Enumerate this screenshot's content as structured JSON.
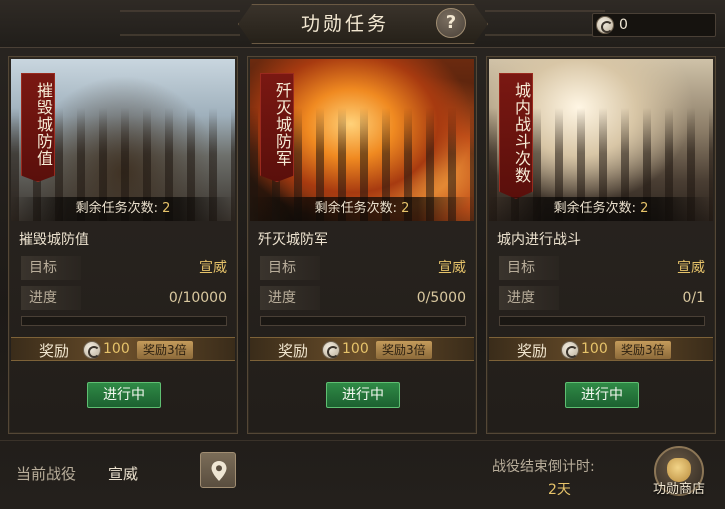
{
  "header": {
    "title": "功勋任务",
    "help_label": "?",
    "currency_value": "0"
  },
  "cards": [
    {
      "banner": "摧毁城防值",
      "remaining_label": "剩余任务次数:",
      "remaining_count": "2",
      "name": "摧毁城防值",
      "target_label": "目标",
      "target_value": "宣威",
      "progress_label": "进度",
      "progress_value": "0/10000",
      "progress_fraction": 0,
      "reward_label": "奖励",
      "reward_amount": "100",
      "reward_multiplier": "奖励3倍",
      "status": "进行中"
    },
    {
      "banner": "歼灭城防军",
      "remaining_label": "剩余任务次数:",
      "remaining_count": "2",
      "name": "歼灭城防军",
      "target_label": "目标",
      "target_value": "宣威",
      "progress_label": "进度",
      "progress_value": "0/5000",
      "progress_fraction": 0,
      "reward_label": "奖励",
      "reward_amount": "100",
      "reward_multiplier": "奖励3倍",
      "status": "进行中"
    },
    {
      "banner": "城内战斗次数",
      "remaining_label": "剩余任务次数:",
      "remaining_count": "2",
      "name": "城内进行战斗",
      "target_label": "目标",
      "target_value": "宣威",
      "progress_label": "进度",
      "progress_value": "0/1",
      "progress_fraction": 0,
      "reward_label": "奖励",
      "reward_amount": "100",
      "reward_multiplier": "奖励3倍",
      "status": "进行中"
    }
  ],
  "footer": {
    "campaign_label": "当前战役",
    "campaign_value": "宣威",
    "countdown_label": "战役结束倒计时:",
    "countdown_value": "2天",
    "shop_label": "功勋商店"
  },
  "icons": {
    "coin": "merit-coin-icon",
    "map": "map-pin-icon",
    "shop": "money-bag-icon"
  },
  "colors": {
    "accent_gold": "#e6c36a",
    "status_green": "#2f8a46",
    "banner_red": "#7a1812"
  }
}
